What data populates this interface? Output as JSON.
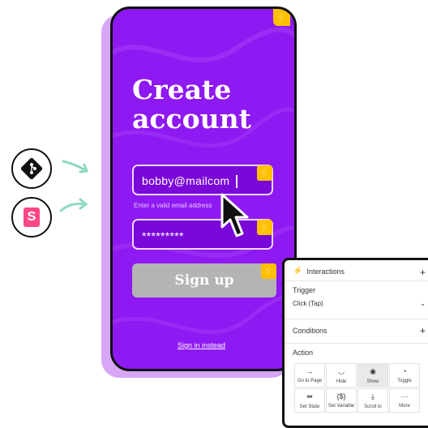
{
  "phone": {
    "title_line1": "Create",
    "title_line2": "account",
    "email_value": "bobby@mailcom",
    "email_hint": "Enter a valid email address",
    "password_value": "*********",
    "signup_label": "Sign up",
    "signin_label": "Sign in instead",
    "bolt_icon": "lightning-icon"
  },
  "panel": {
    "title": "Interactions",
    "trigger_label": "Trigger",
    "trigger_value": "Click (Tap)",
    "conditions_label": "Conditions",
    "action_label": "Action",
    "actions": [
      {
        "icon": "→",
        "label": "Go to Page"
      },
      {
        "icon": "◡",
        "label": "Hide"
      },
      {
        "icon": "◉",
        "label": "Show"
      },
      {
        "icon": "◔",
        "label": "Toggle"
      },
      {
        "icon": "⇹",
        "label": "Set State"
      },
      {
        "icon": "{$}",
        "label": "Set Variable"
      },
      {
        "icon": "⤓",
        "label": "Scroll to"
      },
      {
        "icon": "···",
        "label": "More"
      }
    ],
    "selected_action": "Show"
  },
  "colors": {
    "phone_bg": "#8f19f2",
    "accent_bolt": "#ffc000",
    "field_bg": "#7a08d9",
    "shadow_card": "#d7a6f7",
    "arrow_teal": "#8fd9c0",
    "storybook_pink": "#ff4785"
  },
  "logos": [
    "git-logo-icon",
    "storybook-logo-icon"
  ]
}
